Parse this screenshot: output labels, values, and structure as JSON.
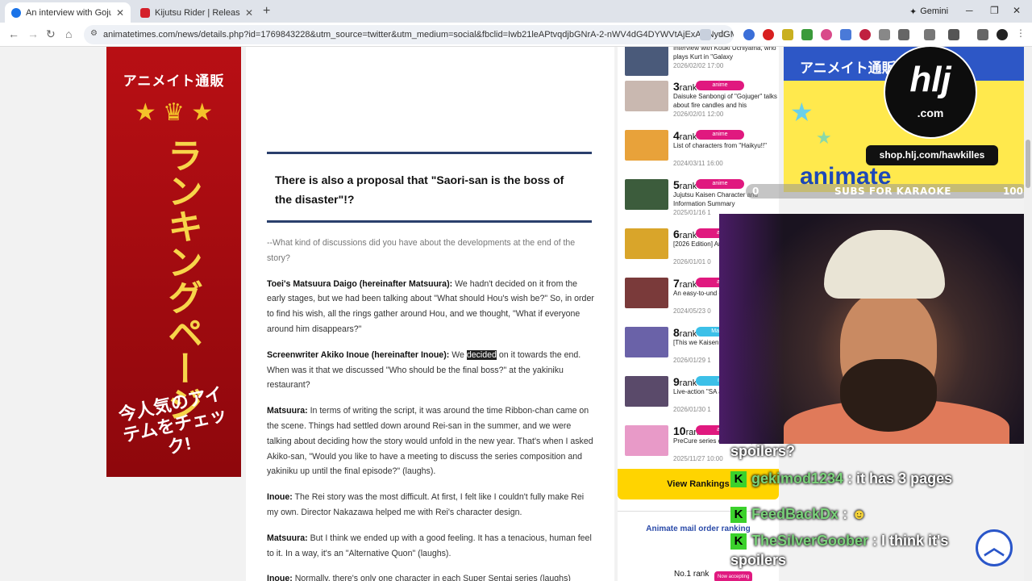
{
  "browser": {
    "tabs": [
      {
        "title": "An interview with Gojuger scre",
        "active": true,
        "icon_color": "#1a73e8"
      },
      {
        "title": "Kijutsu Rider | Release Date Tra",
        "active": false,
        "icon_color": "#d4202a"
      }
    ],
    "gemini_label": "Gemini",
    "url": "animatetimes.com/news/details.php?id=1769843228&utm_source=twitter&utm_medium=social&fbclid=Iwb21leAPtvqdjbGNrA-2-nWV4dG4DYWVtAjExAHNydGMGYXBwX2lkD..."
  },
  "left_ad": {
    "brand": "アニメイト通販",
    "vertical_text": "ランキングページ",
    "bottom_text": "今人気のアイテムをチェック!"
  },
  "article": {
    "headline": "There is also a proposal that \"Saori-san is the boss of the disaster\"!?",
    "paragraphs": [
      {
        "speaker": "",
        "text": "--What kind of discussions did you have about the developments at the end of the story?",
        "question": true
      },
      {
        "speaker": "Toei's Matsuura Daigo (hereinafter Matsuura):",
        "text": " We hadn't decided on it from the early stages, but we had been talking about \"What should Hou's wish be?\" So, in order to find his wish, all the rings gather around Hou, and we thought, \"What if everyone around him disappears?\""
      },
      {
        "speaker": "Screenwriter Akiko Inoue (hereinafter Inoue):",
        "text_before": " We ",
        "highlight": "decided",
        "text": " on it towards the end. When was it that we discussed \"Who should be the final boss?\" at the yakiniku restaurant?"
      },
      {
        "speaker": "Matsuura:",
        "text": " In terms of writing the script, it was around the time Ribbon-chan came on the scene. Things had settled down around Rei-san in the summer, and we were talking about deciding how the story would unfold in the new year. That's when I asked Akiko-san, \"Would you like to have a meeting to discuss the series composition and yakiniku up until the final episode?\" (laughs)."
      },
      {
        "speaker": "Inoue:",
        "text": " The Rei story was the most difficult. At first, I felt like I couldn't fully make Rei my own. Director Nakazawa helped me with Rei's character design."
      },
      {
        "speaker": "Matsuura:",
        "text": " But I think we ended up with a good feeling. It has a tenacious, human feel to it. In a way, it's an \"Alternative Quon\" (laughs)."
      },
      {
        "speaker": "Inoue:",
        "text": " Normally, there's only one character in each Super Sentai series (laughs)"
      }
    ]
  },
  "ranking": {
    "items": [
      {
        "rank": "",
        "badge": "",
        "title": "Interview with Kouki Uchiyama, who plays Kurt in \"Galaxy",
        "date": "2026/02/02 17:00",
        "thumb": "#4a5a7a"
      },
      {
        "rank": "3",
        "badge": "anime",
        "title": "Daisuke Sanbongi of \"Gojuger\" talks about fire candles and his",
        "date": "2026/02/01 12:00",
        "thumb": "#c9b8b0"
      },
      {
        "rank": "4",
        "badge": "anime",
        "title": "List of characters from \"Haikyu!!\"",
        "date": "2024/03/11 16:00",
        "thumb": "#e8a23a"
      },
      {
        "rank": "5",
        "badge": "anime",
        "title": "Jujutsu Kaisen Character and Information Summary",
        "date": "2025/01/16 1",
        "thumb": "#3c5c3c"
      },
      {
        "rank": "6",
        "badge": "an",
        "title": "[2026 Edition] Anime Ranking",
        "date": "2026/01/01 0",
        "thumb": "#d9a52a"
      },
      {
        "rank": "7",
        "badge": "an",
        "title": "An easy-to-und explanation of",
        "date": "2024/05/23 0",
        "thumb": "#7a3a3a"
      },
      {
        "rank": "8",
        "badge": "Manga",
        "title": "[This we Kaisen ≡ (Mod",
        "date": "2026/01/29 1",
        "thumb": "#6a62a8"
      },
      {
        "rank": "9",
        "badge": "m",
        "title": "Live-action \"SA adds Takumi Ki",
        "date": "2026/01/30 1",
        "thumb": "#5a4a6a"
      },
      {
        "rank": "10",
        "badge": "an",
        "title": "PreCure series characters (23+",
        "date": "2025/11/27 10:00",
        "thumb": "#e89ac8"
      }
    ],
    "rank_suffix": "rank",
    "view_rankings": "View Rankings",
    "mail_order_title": "Animate mail order ranking",
    "no1": "No.1 rank",
    "now_accepting": "Now accepting"
  },
  "right_ad": {
    "header": "アニメイト通販",
    "logo": "animate"
  },
  "stream_overlay": {
    "hlj_logo": "hlj",
    "hlj_tld": ".com",
    "shop_url": "shop.hlj.com/hawkilles",
    "progress_min": "0",
    "progress_label": "SUBS FOR KARAOKE",
    "progress_max": "100",
    "progress_value": 0,
    "chat": [
      {
        "user": "",
        "message": "spoilers?"
      },
      {
        "user": "gekimod1234",
        "message": " : it has 3 pages"
      },
      {
        "user": "FeedBackDx",
        "message": " : "
      },
      {
        "user": "TheSilverGoober",
        "message": " : I think it's"
      },
      {
        "user": "",
        "message": "spoilers"
      }
    ],
    "chat_badge": "K"
  },
  "colors": {
    "accent_blue": "#2a3f6c",
    "badge_pink": "#e0197f",
    "view_rankings_bg": "#ffd400",
    "progress_green": "#2eb34c"
  }
}
